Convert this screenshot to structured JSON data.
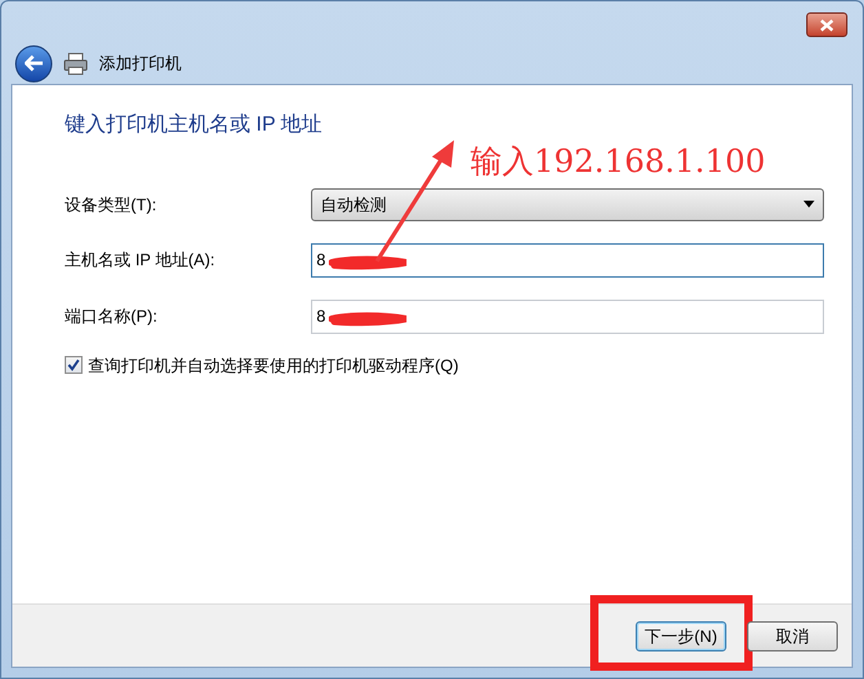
{
  "window": {
    "title": "添加打印机",
    "back_button": {
      "disabled": false
    }
  },
  "heading": "键入打印机主机名或 IP 地址",
  "form": [
    {
      "kind": "dropdown",
      "label": "设备类型(T):",
      "value": "自动检测"
    },
    {
      "kind": "text",
      "label": "主机名或 IP 地址(A):",
      "value": "8",
      "redacted": true,
      "focused": true
    },
    {
      "kind": "text",
      "label": "端口名称(P):",
      "value": "8",
      "redacted": true,
      "focused": false
    }
  ],
  "query_checkbox": {
    "label": "查询打印机并自动选择要使用的打印机驱动程序(Q)",
    "checked": true
  },
  "buttons": [
    {
      "label": "下一步(N)",
      "default": true,
      "highlighted": true
    },
    {
      "label": "取消",
      "default": false,
      "highlighted": false
    }
  ],
  "annotation": {
    "text": "输入192.168.1.100"
  }
}
